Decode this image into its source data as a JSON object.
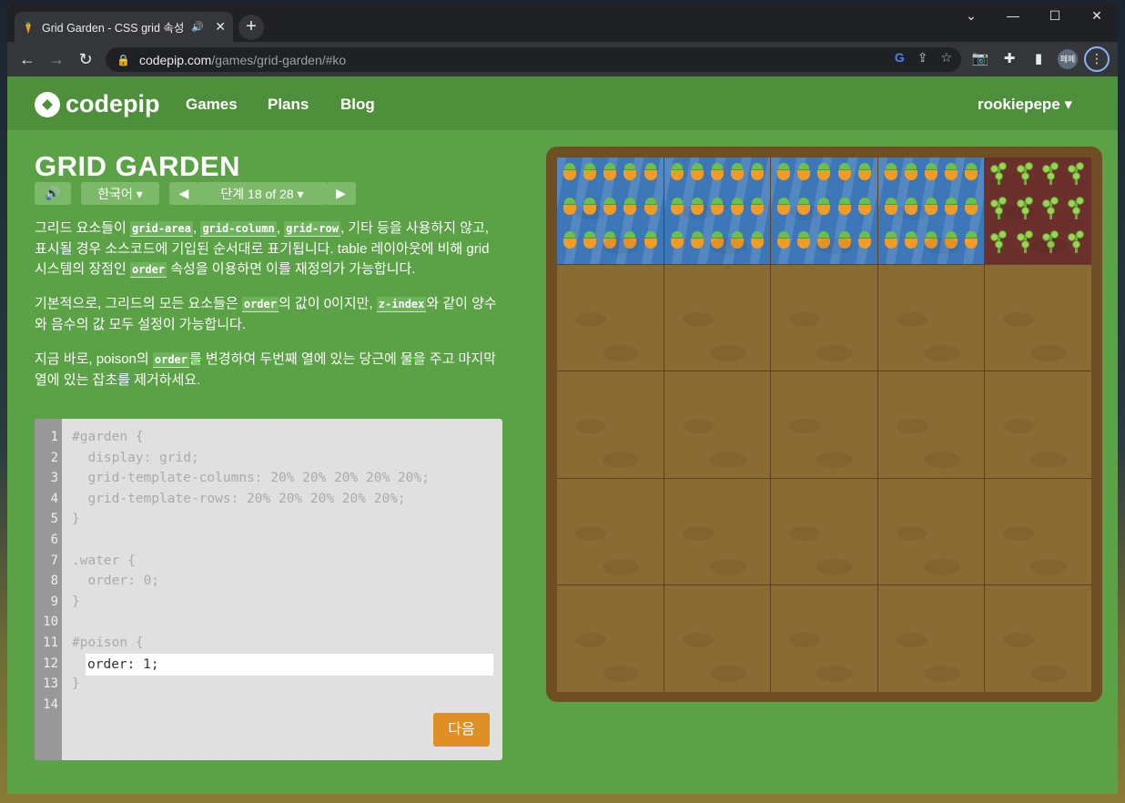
{
  "browser": {
    "tab_title": "Grid Garden - CSS grid 속성",
    "tab_close": "✕",
    "new_tab": "+",
    "url_host": "codepip.com",
    "url_path": "/games/grid-garden/#ko",
    "profile_label": "페페",
    "window_controls": {
      "minimize": "—",
      "maximize": "☐",
      "close": "✕",
      "down": "⌄"
    }
  },
  "site": {
    "logo": "codepip",
    "nav": [
      "Games",
      "Plans",
      "Blog"
    ],
    "user": "rookiepepe ▾"
  },
  "game": {
    "title": "GRID GARDEN",
    "language": "한국어 ▾",
    "level": "단계 18 of 28 ▾",
    "description": [
      {
        "parts": [
          {
            "t": "그리드 요소들이 "
          },
          {
            "c": "grid-area"
          },
          {
            "t": ", "
          },
          {
            "c": "grid-column"
          },
          {
            "t": ", "
          },
          {
            "c": "grid-row"
          },
          {
            "t": ", 기타 등을 사용하지 않고, 표시될 경우 소스코드에 기입된 순서대로 표기됩니다. table 레이아웃에 비해 grid 시스템의 장점인 "
          },
          {
            "c": "order"
          },
          {
            "t": " 속성을 이용하면 이를 재정의가 가능합니다."
          }
        ]
      },
      {
        "parts": [
          {
            "t": "기본적으로, 그리드의 모든 요소들은 "
          },
          {
            "c": "order"
          },
          {
            "t": "의 값이 0이지만, "
          },
          {
            "c": "z-index"
          },
          {
            "t": "와 같이 양수와 음수의 값 모두 설정이 가능합니다."
          }
        ]
      },
      {
        "parts": [
          {
            "t": "지금 바로, poison의 "
          },
          {
            "c": "order"
          },
          {
            "t": "를 변경하여 두번째 열에 있는 당근에 물을 주고 마지막 열에 있는 잡초를 제거하세요."
          }
        ]
      }
    ],
    "editor": {
      "line_numbers": [
        "1",
        "2",
        "3",
        "4",
        "5",
        "6",
        "7",
        "8",
        "9",
        "10",
        "11",
        "12",
        "13",
        "14"
      ],
      "lines": [
        "#garden {",
        "  display: grid;",
        "  grid-template-columns: 20% 20% 20% 20% 20%;",
        "  grid-template-rows: 20% 20% 20% 20% 20%;",
        "}",
        "",
        ".water {",
        "  order: 0;",
        "}",
        "",
        "#poison {",
        "",
        "}",
        ""
      ],
      "answer_value": "order: 1;",
      "next_button": "다음"
    },
    "garden": {
      "columns": 5,
      "rows": 5,
      "water_tiles": 4,
      "poison_tiles": 1,
      "colors": {
        "border": "#6e4f23",
        "soil": "#8a6b33",
        "water": "#3d77b8",
        "poison": "#6b2f2c",
        "carrot": "#f49b26",
        "leaf": "#6cc04a"
      }
    }
  }
}
